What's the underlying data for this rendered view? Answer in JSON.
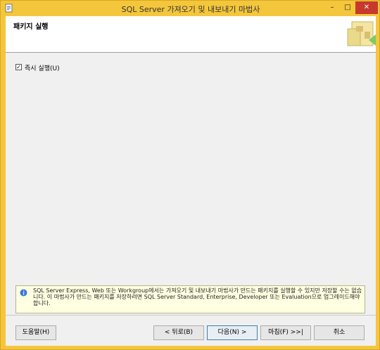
{
  "window": {
    "title": "SQL Server 가져오기 및 내보내기 마법사",
    "icon": "wizard-app-icon",
    "controls": {
      "minimize": "–",
      "maximize": "□",
      "close": "✕"
    }
  },
  "header": {
    "title": "패키지 실행"
  },
  "options": {
    "run_immediately": {
      "label": "즉시 실행(U)",
      "checked": true,
      "mark": "✓"
    }
  },
  "info": {
    "text": "SQL Server Express, Web 또는 Workgroup에서는 가져오기 및 내보내기 마법사가 만드는 패키지를 실행할 수 있지만 저장할 수는 없습니다. 이 마법사가 만드는 패키지를 저장하려면 SQL Server Standard, Enterprise, Developer 또는 Evaluation으로 업그레이드해야 합니다."
  },
  "buttons": {
    "help": "도움말(H)",
    "back": "< 뒤로(B)",
    "next": "다음(N) >",
    "finish": "마침(F) >>|",
    "cancel": "취소"
  },
  "colors": {
    "frame": "#f4c63c",
    "close": "#c7392b",
    "info_bg": "#ffffe1"
  }
}
